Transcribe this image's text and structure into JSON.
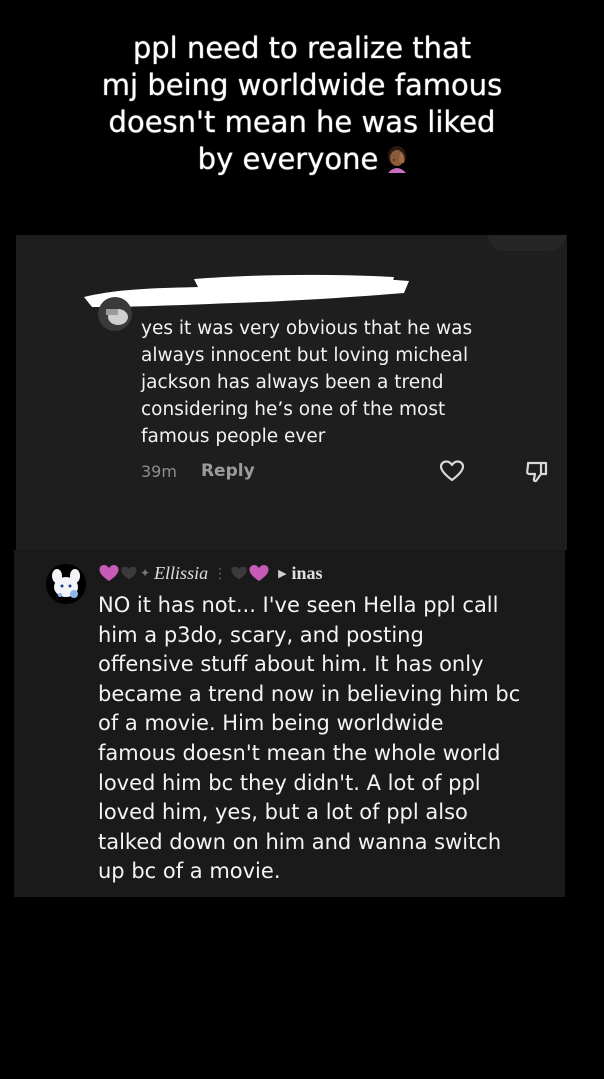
{
  "caption": {
    "lines": [
      "ppl need to realize that",
      "mj being worldwide famous",
      "doesn't mean he was liked",
      "by everyone"
    ],
    "emoji": "woman-facepalming-emoji"
  },
  "comment1": {
    "lines": [
      "yes it was very obvious that he was",
      "always innocent but loving micheal",
      "jackson has always been a trend",
      "considering he’s one of the most",
      "famous people ever"
    ],
    "time": "39m",
    "reply_label": "Reply",
    "icons": [
      "heart-outline-icon",
      "dislike-icon"
    ]
  },
  "comment2": {
    "author": "Ellissia",
    "reply_to": "inas",
    "heart_colors": [
      "#c95bb8",
      "#3a3a3a",
      "#3a3a3a",
      "#c95bb8"
    ],
    "lines": [
      "NO it has not... I've seen Hella ppl call",
      "him a p3do, scary, and posting",
      "offensive stuff about him. It has only",
      "became a trend now in believing him bc",
      "of a movie. Him being worldwide",
      "famous doesn't mean the whole world",
      "loved him bc they didn't. A lot of ppl",
      "loved him, yes, but a lot of ppl also",
      "talked down on him and wanna switch",
      "up bc of a movie."
    ]
  }
}
